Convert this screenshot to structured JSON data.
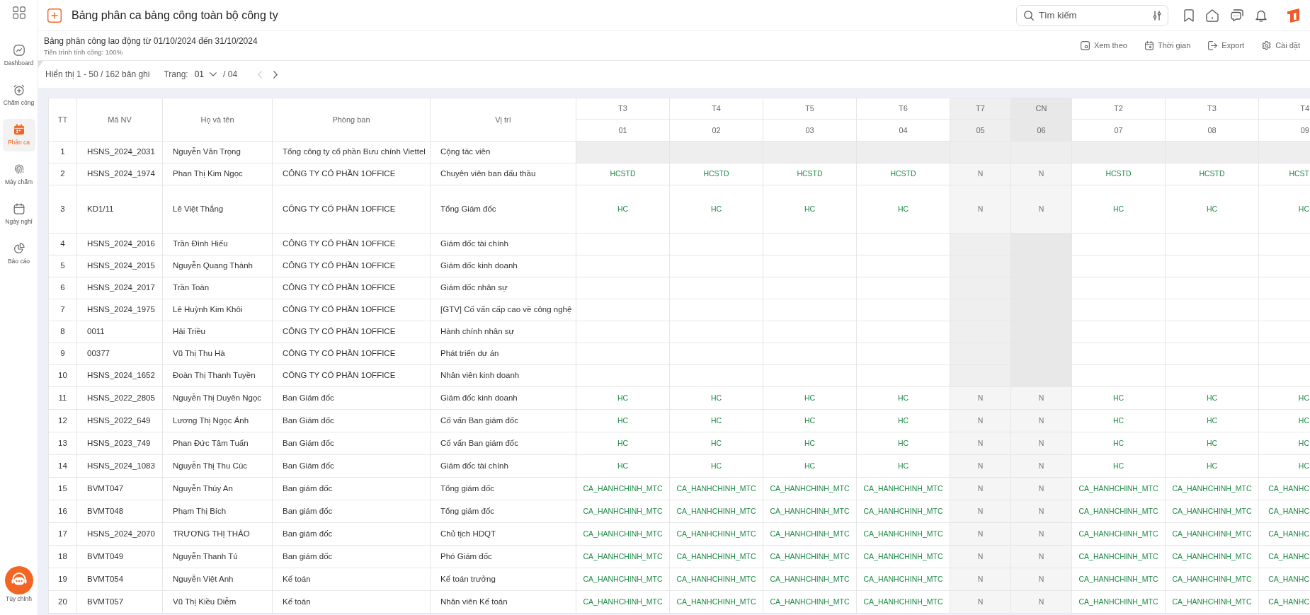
{
  "sidebar": {
    "items": [
      {
        "label": "Dashboard",
        "selected": false
      },
      {
        "label": "Chấm công",
        "selected": false
      },
      {
        "label": "Phân ca",
        "selected": true
      },
      {
        "label": "Máy chấm",
        "selected": false
      },
      {
        "label": "Ngày nghỉ",
        "selected": false
      },
      {
        "label": "Báo cáo",
        "selected": false
      }
    ],
    "footer": {
      "label": "Tùy chỉnh"
    }
  },
  "header": {
    "title": "Bảng phân ca bảng công toàn bộ công ty",
    "search": {
      "placeholder": "Tìm kiếm"
    }
  },
  "summary": {
    "title": "Bảng phân công lao động từ 01/10/2024 đến 31/10/2024",
    "progress": "Tiến trình tính công: 100%",
    "actions": [
      "Xem theo",
      "Thời gian",
      "Export",
      "Cài đặt"
    ]
  },
  "pagination": {
    "range": "Hiển thị 1 - 50 / 162 bản ghi",
    "page_label": "Trang:",
    "page": "01",
    "page_count": "/ 04",
    "buttons": [
      {
        "kind": "previous",
        "disabled": true
      },
      {
        "kind": "next",
        "disabled": false
      }
    ]
  },
  "table": {
    "columns": [
      "TT",
      "Mã NV",
      "Họ và tên",
      "Phòng ban",
      "Vị trí"
    ],
    "days": [
      {
        "weekday": "T3",
        "date": "01",
        "kind": "weekday"
      },
      {
        "weekday": "T4",
        "date": "02",
        "kind": "weekday"
      },
      {
        "weekday": "T5",
        "date": "03",
        "kind": "weekday"
      },
      {
        "weekday": "T6",
        "date": "04",
        "kind": "weekday"
      },
      {
        "weekday": "T7",
        "date": "05",
        "kind": "saturday"
      },
      {
        "weekday": "CN",
        "date": "06",
        "kind": "sunday"
      },
      {
        "weekday": "T2",
        "date": "07",
        "kind": "weekday"
      },
      {
        "weekday": "T3",
        "date": "08",
        "kind": "weekday"
      },
      {
        "weekday": "T4",
        "date": "09",
        "kind": "weekday"
      }
    ],
    "rows": [
      {
        "cells": [
          "1",
          "HSNS_2024_2031",
          "Nguyễn Văn Trọng",
          "Tổng công ty cổ phần Bưu chính Viettel",
          "Cộng tác viên"
        ],
        "disabled": true
      },
      {
        "cells": [
          "2",
          "HSNS_2024_1974",
          "Phan Thị Kim Ngọc",
          "CÔNG TY CỔ PHẦN 1OFFICE",
          "Chuyên viên ban đấu thầu"
        ],
        "disabled": false,
        "shifts": [
          "HCSTD",
          "HCSTD",
          "HCSTD",
          "HCSTD",
          "N",
          "N",
          "HCSTD",
          "HCSTD",
          "HCST"
        ]
      },
      {
        "cells": [
          "3",
          "KD1/11",
          "Lê Việt Thắng",
          "CÔNG TY CỔ PHẦN 1OFFICE",
          "Tổng Giám đốc"
        ],
        "disabled": false,
        "shifts": [
          "HC",
          "HC",
          "HC",
          "HC",
          "N",
          "N",
          "HC",
          "HC",
          "HC"
        ]
      },
      {
        "cells": [
          "4",
          "HSNS_2024_2016",
          "Trần Đình Hiếu",
          "CÔNG TY CỔ PHẦN 1OFFICE",
          "Giám đốc tài chính"
        ],
        "disabled": false
      },
      {
        "cells": [
          "5",
          "HSNS_2024_2015",
          "Nguyễn Quang Thành",
          "CÔNG TY CỔ PHẦN 1OFFICE",
          "Giám đốc kinh doanh"
        ],
        "disabled": false
      },
      {
        "cells": [
          "6",
          "HSNS_2024_2017",
          "Trần Toàn",
          "CÔNG TY CỔ PHẦN 1OFFICE",
          "Giám đốc nhân sự"
        ],
        "disabled": false
      },
      {
        "cells": [
          "7",
          "HSNS_2024_1975",
          "Lê Huỳnh Kim Khôi",
          "CÔNG TY CỔ PHẦN 1OFFICE",
          "[GTV] Cố vấn cấp cao về công nghệ"
        ],
        "disabled": false
      },
      {
        "cells": [
          "8",
          "0011",
          "Hải Triều",
          "CÔNG TY CỔ PHẦN 1OFFICE",
          "Hành chính nhân sự"
        ],
        "disabled": false
      },
      {
        "cells": [
          "9",
          "00377",
          "Vũ Thị Thu Hà",
          "CÔNG TY CỔ PHẦN 1OFFICE",
          "Phát triển dự án"
        ],
        "disabled": false
      },
      {
        "cells": [
          "10",
          "HSNS_2024_1652",
          "Đoàn Thị Thanh Tuyền",
          "CÔNG TY CỔ PHẦN 1OFFICE",
          "Nhân viên kinh doanh"
        ],
        "disabled": false
      },
      {
        "cells": [
          "11",
          "HSNS_2022_2805",
          "Nguyễn Thị Duyên Ngọc",
          "Ban Giám đốc",
          "Giám đốc kinh doanh"
        ],
        "disabled": false,
        "shifts": [
          "HC",
          "HC",
          "HC",
          "HC",
          "N",
          "N",
          "HC",
          "HC",
          "HC"
        ]
      },
      {
        "cells": [
          "12",
          "HSNS_2022_649",
          "Lương Thị Ngọc Ánh",
          "Ban Giám đốc",
          "Cố vấn Ban giám đốc"
        ],
        "disabled": false,
        "shifts": [
          "HC",
          "HC",
          "HC",
          "HC",
          "N",
          "N",
          "HC",
          "HC",
          "HC"
        ]
      },
      {
        "cells": [
          "13",
          "HSNS_2023_749",
          "Phan Đức Tâm Tuấn",
          "Ban Giám đốc",
          "Cố vấn Ban giám đốc"
        ],
        "disabled": false,
        "shifts": [
          "HC",
          "HC",
          "HC",
          "HC",
          "N",
          "N",
          "HC",
          "HC",
          "HC"
        ]
      },
      {
        "cells": [
          "14",
          "HSNS_2024_1083",
          "Nguyễn Thị Thu Cúc",
          "Ban Giám đốc",
          "Giám đốc tài chính"
        ],
        "disabled": false,
        "shifts": [
          "HC",
          "HC",
          "HC",
          "HC",
          "N",
          "N",
          "HC",
          "HC",
          "HC"
        ]
      },
      {
        "cells": [
          "15",
          "BVMT047",
          "Nguyễn Thúy An",
          "Ban giám đốc",
          "Tổng giám đốc"
        ],
        "disabled": false,
        "shifts": [
          "CA_HANHCHINH_MTC",
          "CA_HANHCHINH_MTC",
          "CA_HANHCHINH_MTC",
          "CA_HANHCHINH_MTC",
          "N",
          "N",
          "CA_HANHCHINH_MTC",
          "CA_HANHCHINH_MTC",
          "CA_HANHC"
        ]
      },
      {
        "cells": [
          "16",
          "BVMT048",
          "Phạm Thị Bích",
          "Ban giám đốc",
          "Tổng giám đốc"
        ],
        "disabled": false,
        "shifts": [
          "CA_HANHCHINH_MTC",
          "CA_HANHCHINH_MTC",
          "CA_HANHCHINH_MTC",
          "CA_HANHCHINH_MTC",
          "N",
          "N",
          "CA_HANHCHINH_MTC",
          "CA_HANHCHINH_MTC",
          "CA_HANHC"
        ]
      },
      {
        "cells": [
          "17",
          "HSNS_2024_2070",
          "TRƯƠNG THỊ THẢO",
          "Ban giám đốc",
          "Chủ tịch HDQT"
        ],
        "disabled": false,
        "shifts": [
          "CA_HANHCHINH_MTC",
          "CA_HANHCHINH_MTC",
          "CA_HANHCHINH_MTC",
          "CA_HANHCHINH_MTC",
          "N",
          "N",
          "CA_HANHCHINH_MTC",
          "CA_HANHCHINH_MTC",
          "CA_HANHC"
        ]
      },
      {
        "cells": [
          "18",
          "BVMT049",
          "Nguyễn Thanh Tú",
          "Ban giám đốc",
          "Phó Giám đốc"
        ],
        "disabled": false,
        "shifts": [
          "CA_HANHCHINH_MTC",
          "CA_HANHCHINH_MTC",
          "CA_HANHCHINH_MTC",
          "CA_HANHCHINH_MTC",
          "N",
          "N",
          "CA_HANHCHINH_MTC",
          "CA_HANHCHINH_MTC",
          "CA_HANHC"
        ]
      },
      {
        "cells": [
          "19",
          "BVMT054",
          "Nguyễn Việt Anh",
          "Kế toán",
          "Kế toán trưởng"
        ],
        "disabled": false,
        "shifts": [
          "CA_HANHCHINH_MTC",
          "CA_HANHCHINH_MTC",
          "CA_HANHCHINH_MTC",
          "CA_HANHCHINH_MTC",
          "N",
          "N",
          "CA_HANHCHINH_MTC",
          "CA_HANHCHINH_MTC",
          "CA_HANHC"
        ]
      },
      {
        "cells": [
          "20",
          "BVMT057",
          "Vũ Thị Kiều Diễm",
          "Kế toán",
          "Nhân viên Kế toán"
        ],
        "disabled": false,
        "shifts": [
          "CA_HANHCHINH_MTC",
          "CA_HANHCHINH_MTC",
          "CA_HANHCHINH_MTC",
          "CA_HANHCHINH_MTC",
          "N",
          "N",
          "CA_HANHCHINH_MTC",
          "CA_HANHCHINH_MTC",
          "CA_HANHC"
        ]
      }
    ]
  }
}
